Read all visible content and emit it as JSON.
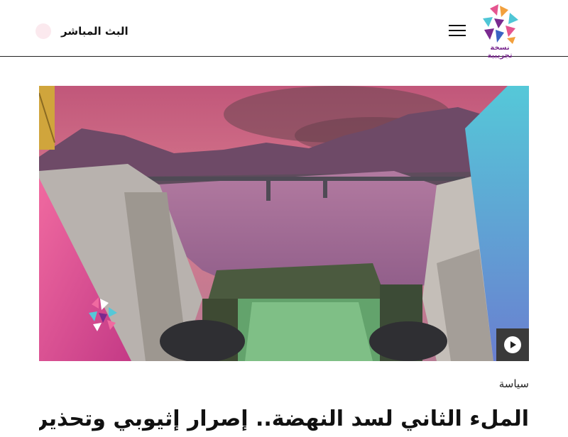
{
  "header": {
    "logo_caption": "نسخة تجريبية",
    "live_label": "البث المباشر"
  },
  "article": {
    "category": "سياسة",
    "headline": "الملء الثاني لسد النهضة.. إصرار إثيوبي وتحذير"
  },
  "icons": {
    "menu": "hamburger-icon",
    "play": "play-icon",
    "logo": "channel-logo-icon",
    "watermark": "channel-watermark-icon"
  },
  "colors": {
    "brand_purple": "#7a2a8f",
    "brand_pink": "#e5558f",
    "brand_cyan": "#4fc6d6"
  }
}
